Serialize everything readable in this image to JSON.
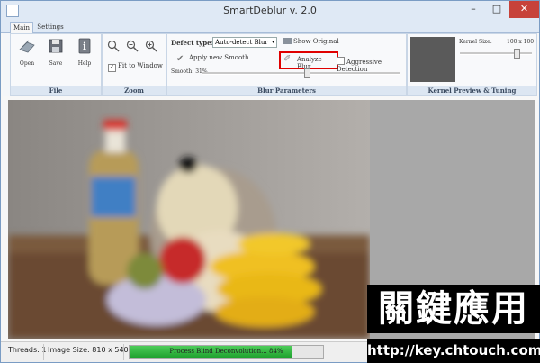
{
  "window": {
    "title": "SmartDeblur v. 2.0",
    "minimize": "–",
    "maximize": "□",
    "close": "✕"
  },
  "tabs": [
    {
      "label": "Main"
    },
    {
      "label": "Settings"
    }
  ],
  "ribbon": {
    "file": {
      "caption": "File",
      "open": "Open",
      "save": "Save",
      "help": "Help"
    },
    "zoom": {
      "caption": "Zoom",
      "fit_label": "Fit to Window"
    },
    "blur": {
      "caption": "Blur Parameters",
      "defect_label": "Defect type:",
      "defect_value": "Auto-detect Blur",
      "show_original": "Show Original",
      "apply_new": "Apply new Smooth",
      "analyze": "Analyze Blur",
      "aggressive": "Aggressive Detection",
      "smooth_label": "Smooth: 31%"
    },
    "kernel": {
      "caption": "Kernel Preview & Tuning",
      "size_label": "Kernel Size:",
      "size_value": "100 x 100"
    }
  },
  "status": {
    "threads": "Threads: 1",
    "image_size": "Image Size: 810 x 540",
    "progress_text": "Process Blind Deconvolution... 84%",
    "progress_value": 0.84
  },
  "watermark": {
    "cjk": "關鍵應用",
    "url": "http://key.chtouch.com"
  },
  "colors": {
    "accent": "#dfe9f5",
    "progress": "#2bb43a",
    "highlight": "#e00000"
  }
}
